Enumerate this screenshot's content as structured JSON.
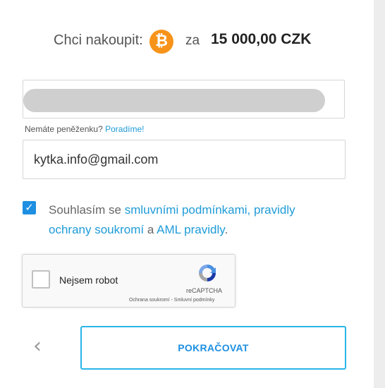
{
  "header": {
    "label": "Chci nakoupit:",
    "currency_icon": "bitcoin-icon",
    "currency_symbol": "₿",
    "connector": "za",
    "amount": "15 000,00 CZK",
    "accent_color": "#f7931a"
  },
  "wallet": {
    "value_redacted": true,
    "hint_text": "Nemáte peněženku?",
    "hint_link": "Poradíme!"
  },
  "email": {
    "value": "kytka.info@gmail.com"
  },
  "consent": {
    "checked": true,
    "check_glyph": "✓",
    "text_prefix": "Souhlasím se",
    "link_terms": "smluvními podmínkami,",
    "link_privacy": "pravidly ochrany soukromí",
    "text_and": "a",
    "link_aml": "AML pravidly",
    "text_suffix": "."
  },
  "recaptcha": {
    "label": "Nejsem robot",
    "brand": "reCAPTCHA",
    "links": "Ochrana soukromí - Smluvní podmínky"
  },
  "footer": {
    "back_glyph": "‹",
    "continue_label": "POKRAČOVAT",
    "accent_color": "#29b6e8"
  }
}
